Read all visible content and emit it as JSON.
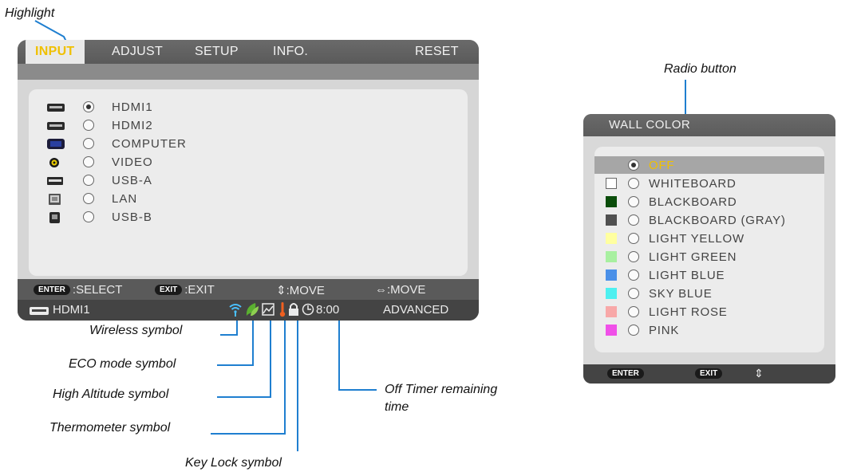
{
  "callouts": {
    "highlight": "Highlight",
    "radio_button": "Radio button",
    "wireless": "Wireless symbol",
    "eco": "ECO mode symbol",
    "high_altitude": "High Altitude symbol",
    "thermometer": "Thermometer symbol",
    "key_lock": "Key Lock symbol",
    "off_timer_line1": "Off Timer remaining",
    "off_timer_line2": "time"
  },
  "main_menu": {
    "tabs": [
      {
        "label": "INPUT",
        "active": true
      },
      {
        "label": "ADJUST"
      },
      {
        "label": "SETUP"
      },
      {
        "label": "INFO."
      },
      {
        "label": "RESET"
      }
    ],
    "inputs": [
      {
        "label": "HDMI1",
        "icon": "hdmi-icon",
        "selected": true
      },
      {
        "label": "HDMI2",
        "icon": "hdmi-icon"
      },
      {
        "label": "COMPUTER",
        "icon": "vga-icon"
      },
      {
        "label": "VIDEO",
        "icon": "video-rca-icon"
      },
      {
        "label": "USB-A",
        "icon": "usb-a-icon"
      },
      {
        "label": "LAN",
        "icon": "lan-icon"
      },
      {
        "label": "USB-B",
        "icon": "usb-b-icon"
      }
    ],
    "hints": {
      "enter_key": "ENTER",
      "select": ":SELECT",
      "exit_key": "EXIT",
      "exit": ":EXIT",
      "move_vertical": "⇕:MOVE",
      "move_horizontal": "⇔:MOVE"
    },
    "status": {
      "source": "HDMI1",
      "timer": "8:00",
      "mode": "ADVANCED"
    }
  },
  "wall_color_menu": {
    "title": "WALL COLOR",
    "options": [
      {
        "label": "OFF",
        "color": null,
        "selected": true
      },
      {
        "label": "WHITEBOARD",
        "color": "#ffffff"
      },
      {
        "label": "BLACKBOARD",
        "color": "#0a4d0a"
      },
      {
        "label": "BLACKBOARD (GRAY)",
        "color": "#505050"
      },
      {
        "label": "LIGHT YELLOW",
        "color": "#ffffa0"
      },
      {
        "label": "LIGHT GREEN",
        "color": "#a8f0a0"
      },
      {
        "label": "LIGHT BLUE",
        "color": "#4a90e8"
      },
      {
        "label": "SKY BLUE",
        "color": "#4ef0f0"
      },
      {
        "label": "LIGHT ROSE",
        "color": "#f8a8a8"
      },
      {
        "label": "PINK",
        "color": "#f050e8"
      }
    ],
    "footer": {
      "enter_key": "ENTER",
      "exit_key": "EXIT",
      "move": "⇕"
    }
  },
  "colors": {
    "callout_line": "#1f7fd0",
    "active_tab_text": "#f0c000",
    "selected_option_text": "#f0c000"
  }
}
